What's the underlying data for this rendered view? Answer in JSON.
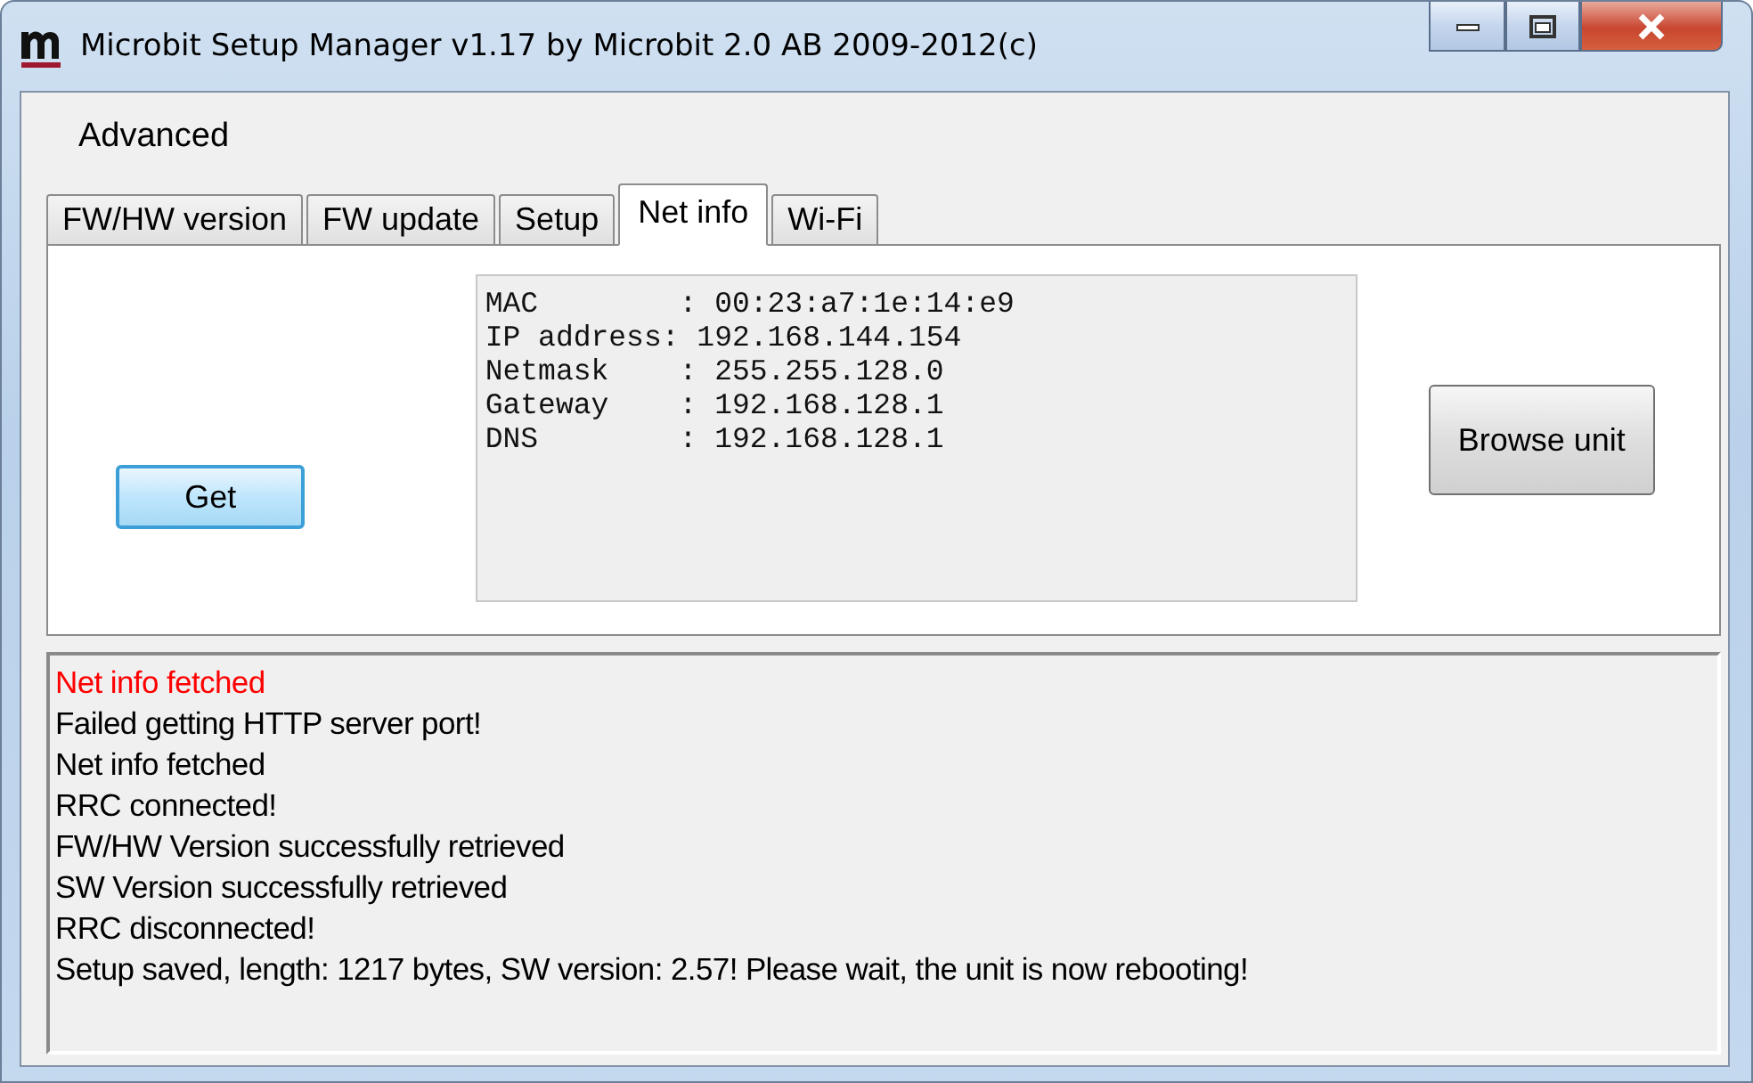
{
  "window": {
    "title": "Microbit Setup Manager v1.17 by Microbit 2.0 AB 2009-2012(c)"
  },
  "menu": [
    "Advanced"
  ],
  "tabs": [
    {
      "label": "FW/HW version",
      "selected": false
    },
    {
      "label": "FW update",
      "selected": false
    },
    {
      "label": "Setup",
      "selected": false
    },
    {
      "label": "Net info",
      "selected": true
    },
    {
      "label": "Wi-Fi",
      "selected": false
    }
  ],
  "get_button": "Get",
  "net_info": [
    "MAC        : 00:23:a7:1e:14:e9",
    "IP address: 192.168.144.154",
    "Netmask    : 255.255.128.0",
    "Gateway    : 192.168.128.1",
    "DNS        : 192.168.128.1"
  ],
  "browse_button": "Browse unit",
  "log": [
    {
      "text": "Net info fetched",
      "color": "#ff0000"
    },
    {
      "text": "Failed getting HTTP server port!",
      "color": "#000000"
    },
    {
      "text": "Net info fetched",
      "color": "#000000"
    },
    {
      "text": "RRC connected!",
      "color": "#000000"
    },
    {
      "text": "FW/HW Version successfully retrieved",
      "color": "#000000"
    },
    {
      "text": "SW Version successfully retrieved",
      "color": "#000000"
    },
    {
      "text": "RRC disconnected!",
      "color": "#000000"
    },
    {
      "text": "Setup saved, length: 1217 bytes, SW version: 2.57! Please wait, the unit is now rebooting!",
      "color": "#000000"
    }
  ]
}
